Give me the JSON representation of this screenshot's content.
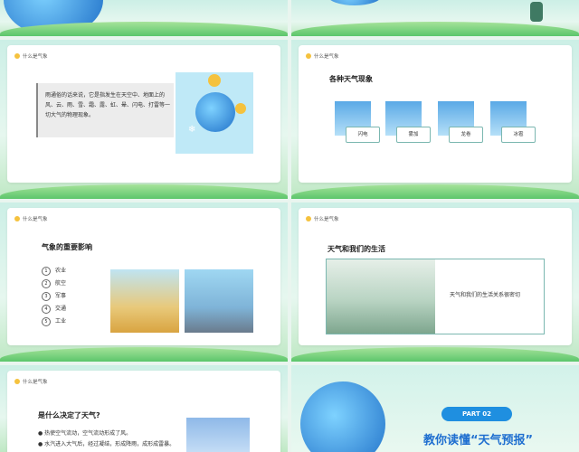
{
  "common": {
    "header_label": "什么是气象"
  },
  "slide2": {
    "text": "雨通俗的话来说，它是指发生在天空中、地面上的风、云、雨、雪、霜、露、虹、晕、闪电、打雷等一切大气的物理现象。"
  },
  "slide3": {
    "title": "各种天气现象",
    "items": [
      "闪电",
      "雾加",
      "龙卷",
      "冰雹"
    ]
  },
  "slide4": {
    "title": "气象的重要影响",
    "items": [
      {
        "num": "1",
        "label": "农业"
      },
      {
        "num": "2",
        "label": "航空"
      },
      {
        "num": "3",
        "label": "军事"
      },
      {
        "num": "4",
        "label": "交通"
      },
      {
        "num": "5",
        "label": "工业"
      }
    ]
  },
  "slide5": {
    "title": "天气和我们的生活",
    "text": "天气和我们的生活关系很密切"
  },
  "slide6": {
    "title": "是什么决定了天气?",
    "bullets": [
      "热使空气流动，空气流动形成了风。",
      "水汽进入大气后，经过凝结，形成降雨，成形成雷暴。"
    ]
  },
  "slide7": {
    "part": "PART 02",
    "title": "教你读懂“天气预报”"
  },
  "colors": {
    "accent": "#1f8fe0",
    "card_border": "#7bb7b0",
    "sun": "#f5c23e",
    "grass": "#5cc66c"
  }
}
